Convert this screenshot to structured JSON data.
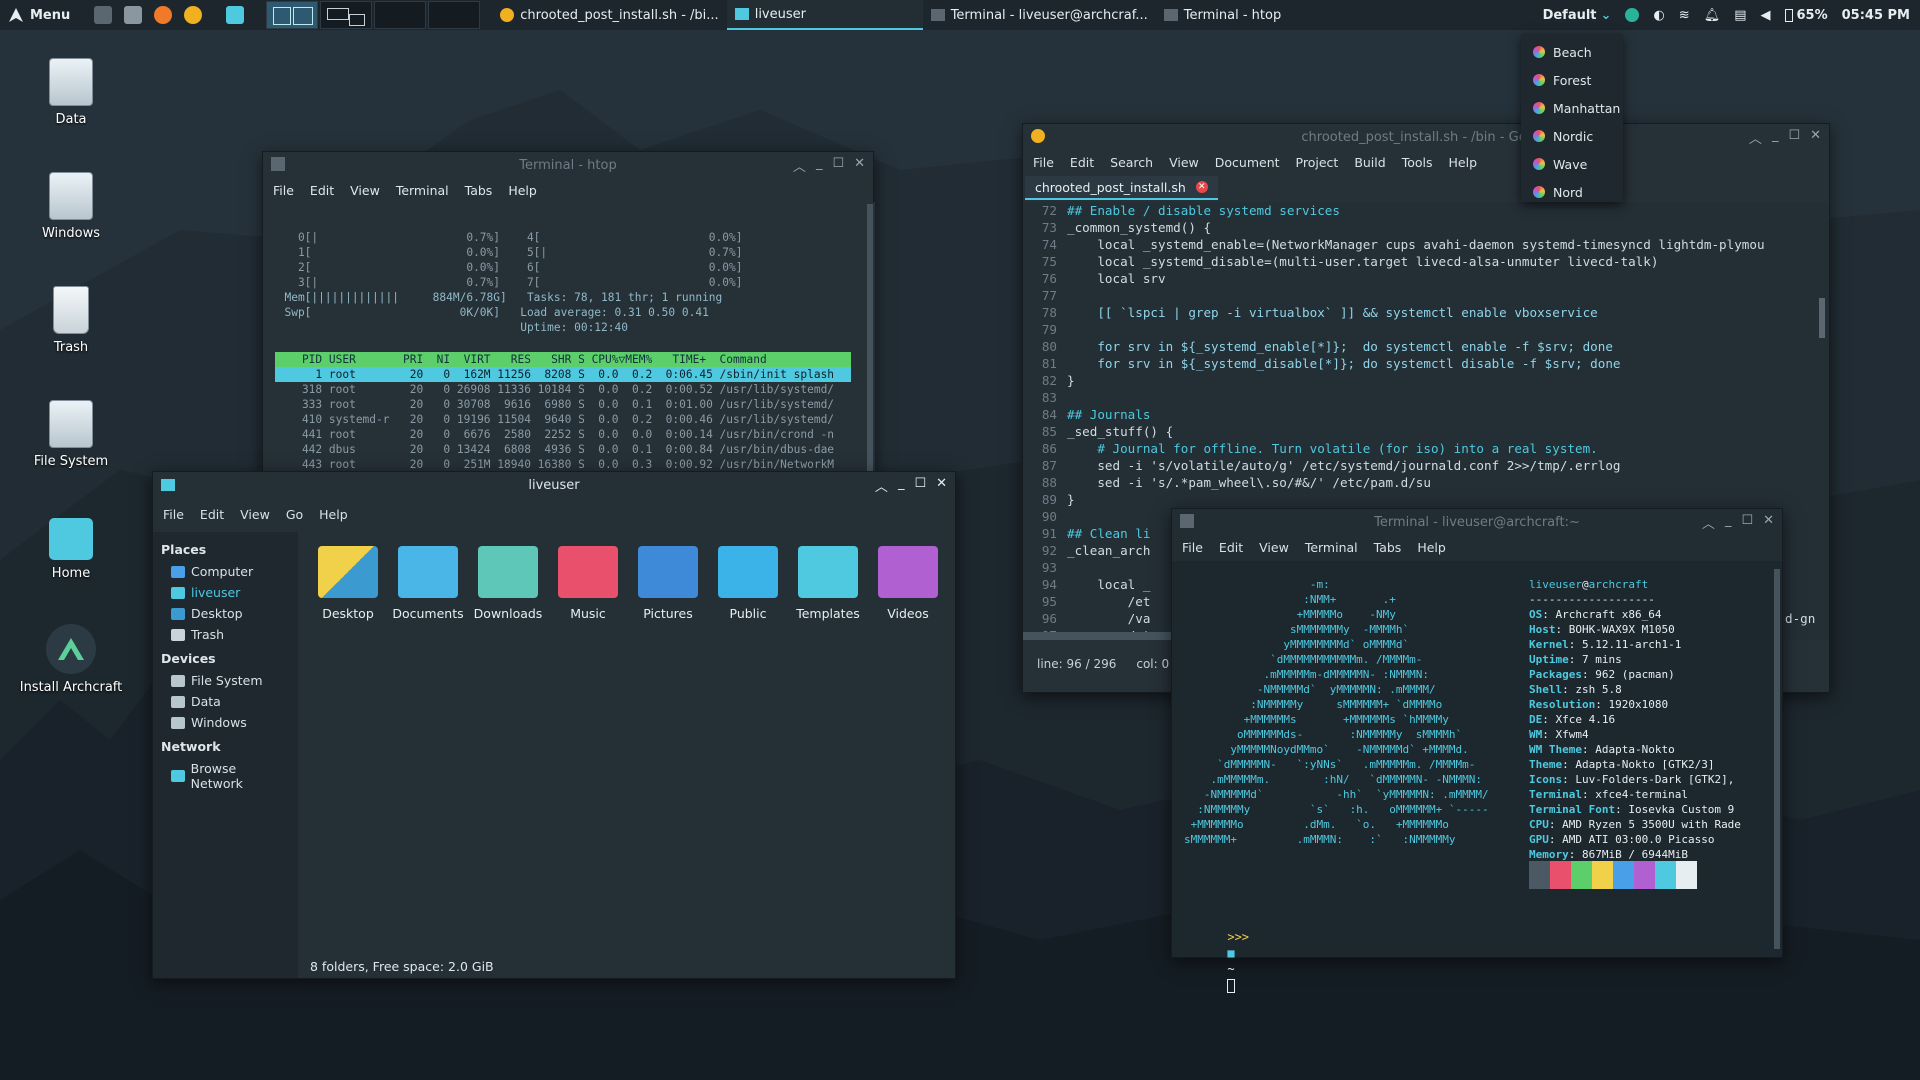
{
  "panel": {
    "menu_label": "Menu",
    "tasks": [
      {
        "label": "chrooted_post_install.sh - /bi..."
      },
      {
        "label": "liveuser"
      },
      {
        "label": "Terminal - liveuser@archcraf..."
      },
      {
        "label": "Terminal - htop"
      }
    ],
    "theme_label": "Default",
    "battery": "65%",
    "clock": "05:45 PM"
  },
  "theme_menu": {
    "items": [
      "Beach",
      "Forest",
      "Manhattan",
      "Nordic",
      "Wave",
      "Nord"
    ]
  },
  "desktop": {
    "icons": [
      "Data",
      "Windows",
      "Trash",
      "File System",
      "Home",
      "Install Archcraft"
    ]
  },
  "htop": {
    "title": "Terminal - htop",
    "menu": [
      "File",
      "Edit",
      "View",
      "Terminal",
      "Tabs",
      "Help"
    ],
    "meter_lines": [
      "    0[|                      0.7%]    4[                         0.0%]",
      "    1[                       0.0%]    5[|                        0.7%]",
      "    2[                       0.0%]    6[                         0.0%]",
      "    3[|                      0.7%]    7[                         0.0%]",
      "  Mem[|||||||||||||     884M/6.78G]   Tasks: 78, 181 thr; 1 running",
      "  Swp[                      0K/0K]   Load average: 0.31 0.50 0.41",
      "                                     Uptime: 00:12:40"
    ],
    "header": "    PID USER       PRI  NI  VIRT   RES   SHR S CPU%▽MEM%   TIME+  Command",
    "selected_row": "      1 root        20   0  162M 11256  8208 S  0.0  0.2  0:06.45 /sbin/init splash",
    "rows": [
      "    318 root        20   0 26908 11336 10184 S  0.0  0.2  0:00.52 /usr/lib/systemd/",
      "    333 root        20   0 30708  9616  6980 S  0.0  0.1  0:01.00 /usr/lib/systemd/",
      "    410 systemd-r   20   0 19196 11504  9640 S  0.0  0.2  0:00.46 /usr/lib/systemd/",
      "    441 root        20   0  6676  2580  2252 S  0.0  0.0  0:00.14 /usr/bin/crond -n",
      "    442 dbus        20   0 13424  6808  4936 S  0.0  0.1  0:00.84 /usr/bin/dbus-dae",
      "    443 root        20   0  251M 18940 16380 S  0.0  0.3  0:00.92 /usr/bin/NetworkM"
    ]
  },
  "filemanager": {
    "title": "liveuser",
    "menu": [
      "File",
      "Edit",
      "View",
      "Go",
      "Help"
    ],
    "sections": {
      "places": "Places",
      "devices": "Devices",
      "network": "Network"
    },
    "places": [
      "Computer",
      "liveuser",
      "Desktop",
      "Trash"
    ],
    "devices": [
      "File System",
      "Data",
      "Windows"
    ],
    "network": [
      "Browse Network"
    ],
    "folders": [
      "Desktop",
      "Documents",
      "Downloads",
      "Music",
      "Pictures",
      "Public",
      "Templates",
      "Videos"
    ],
    "status": "8 folders, Free space: 2.0 GiB"
  },
  "geany": {
    "title": "chrooted_post_install.sh - /bin - Geany",
    "menu": [
      "File",
      "Edit",
      "Search",
      "View",
      "Document",
      "Project",
      "Build",
      "Tools",
      "Help"
    ],
    "tab": "chrooted_post_install.sh",
    "line_numbers": [
      "72",
      "73",
      "74",
      "75",
      "76",
      "77",
      "78",
      "79",
      "80",
      "81",
      "82",
      "83",
      "84",
      "85",
      "86",
      "87",
      "88",
      "89",
      "90",
      "91",
      "92",
      "93",
      "94",
      "95",
      "96",
      "97"
    ],
    "code": [
      "## Enable / disable systemd services",
      "_common_systemd() {",
      "    local _systemd_enable=(NetworkManager cups avahi-daemon systemd-timesyncd lightdm-plymou",
      "    local _systemd_disable=(multi-user.target livecd-alsa-unmuter livecd-talk)",
      "    local srv",
      "",
      "    [[ `lspci | grep -i virtualbox` ]] && systemctl enable vboxservice",
      "",
      "    for srv in ${_systemd_enable[*]};  do systemctl enable -f $srv; done",
      "    for srv in ${_systemd_disable[*]}; do systemctl disable -f $srv; done",
      "}",
      "",
      "## Journals",
      "_sed_stuff() {",
      "    # Journal for offline. Turn volatile (for iso) into a real system.",
      "    sed -i 's/volatile/auto/g' /etc/systemd/journald.conf 2>>/tmp/.errlog",
      "    sed -i 's/.*pam_wheel\\.so/#&/' /etc/pam.d/su",
      "}",
      "",
      "## Clean li",
      "_clean_arch",
      "",
      "    local _",
      "        /et",
      "        /va",
      "        /et"
    ],
    "code_tail": "d-gn",
    "status_line": "line: 96 / 296",
    "status_col": "col: 0"
  },
  "terminal": {
    "title": "Terminal - liveuser@archcraft:~",
    "menu": [
      "File",
      "Edit",
      "View",
      "Terminal",
      "Tabs",
      "Help"
    ],
    "art": [
      "                   -m:",
      "                  :NMM+       .+",
      "                 +MMMMMo    -NMy",
      "                sMMMMMMMy  -MMMMh`",
      "               yMMMMMMMMd` oMMMMd`",
      "             `dMMMMMMMMMMMm. /MMMMm-",
      "            .mMMMMMm-dMMMMMN- :NMMMN:",
      "           -NMMMMMd`  yMMMMMN: .mMMMM/",
      "          :NMMMMMy     sMMMMMM+ `dMMMMo",
      "         +MMMMMMs       +MMMMMMs `hMMMMy",
      "        oMMMMMMds-       :NMMMMMy  sMMMMh`",
      "       yMMMMMNoydMMmo`    -NMMMMMd` +MMMMd.",
      "     `dMMMMMN-   `:yNNs`   .mMMMMMm. /MMMMm-",
      "    .mMMMMMm.        :hN/   `dMMMMMN- -NMMMN:",
      "   -NMMMMMd`           -hh`  `yMMMMMN: .mMMMM/",
      "  :NMMMMMy         `s`   :h.   oMMMMMM+ `-----",
      " +MMMMMMo         .dMm.   `o.   +MMMMMMo",
      "sMMMMMM+         .mMMMN:    :`   :NMMMMMy"
    ],
    "user": "liveuser",
    "at": "@",
    "host": "archcraft",
    "separator": "-------------------",
    "info": [
      {
        "k": "OS",
        "v": " Archcraft x86_64"
      },
      {
        "k": "Host",
        "v": " BOHK-WAX9X M1050"
      },
      {
        "k": "Kernel",
        "v": " 5.12.11-arch1-1"
      },
      {
        "k": "Uptime",
        "v": " 7 mins"
      },
      {
        "k": "Packages",
        "v": " 962 (pacman)"
      },
      {
        "k": "Shell",
        "v": " zsh 5.8"
      },
      {
        "k": "Resolution",
        "v": " 1920x1080"
      },
      {
        "k": "DE",
        "v": " Xfce 4.16"
      },
      {
        "k": "WM",
        "v": " Xfwm4"
      },
      {
        "k": "WM Theme",
        "v": " Adapta-Nokto"
      },
      {
        "k": "Theme",
        "v": " Adapta-Nokto [GTK2/3]"
      },
      {
        "k": "Icons",
        "v": " Luv-Folders-Dark [GTK2],"
      },
      {
        "k": "Terminal",
        "v": " xfce4-terminal"
      },
      {
        "k": "Terminal Font",
        "v": " Iosevka Custom 9"
      },
      {
        "k": "CPU",
        "v": " AMD Ryzen 5 3500U with Rade"
      },
      {
        "k": "GPU",
        "v": " AMD ATI 03:00.0 Picasso"
      },
      {
        "k": "Memory",
        "v": " 867MiB / 6944MiB"
      }
    ],
    "palette": [
      "#4a5963",
      "#e8506c",
      "#5ccf6a",
      "#f2d14a",
      "#4aa0e8",
      "#b060d0",
      "#4ec9e0",
      "#e6eef2"
    ],
    "prompt": ">>>",
    "prompt_dir": "~"
  }
}
